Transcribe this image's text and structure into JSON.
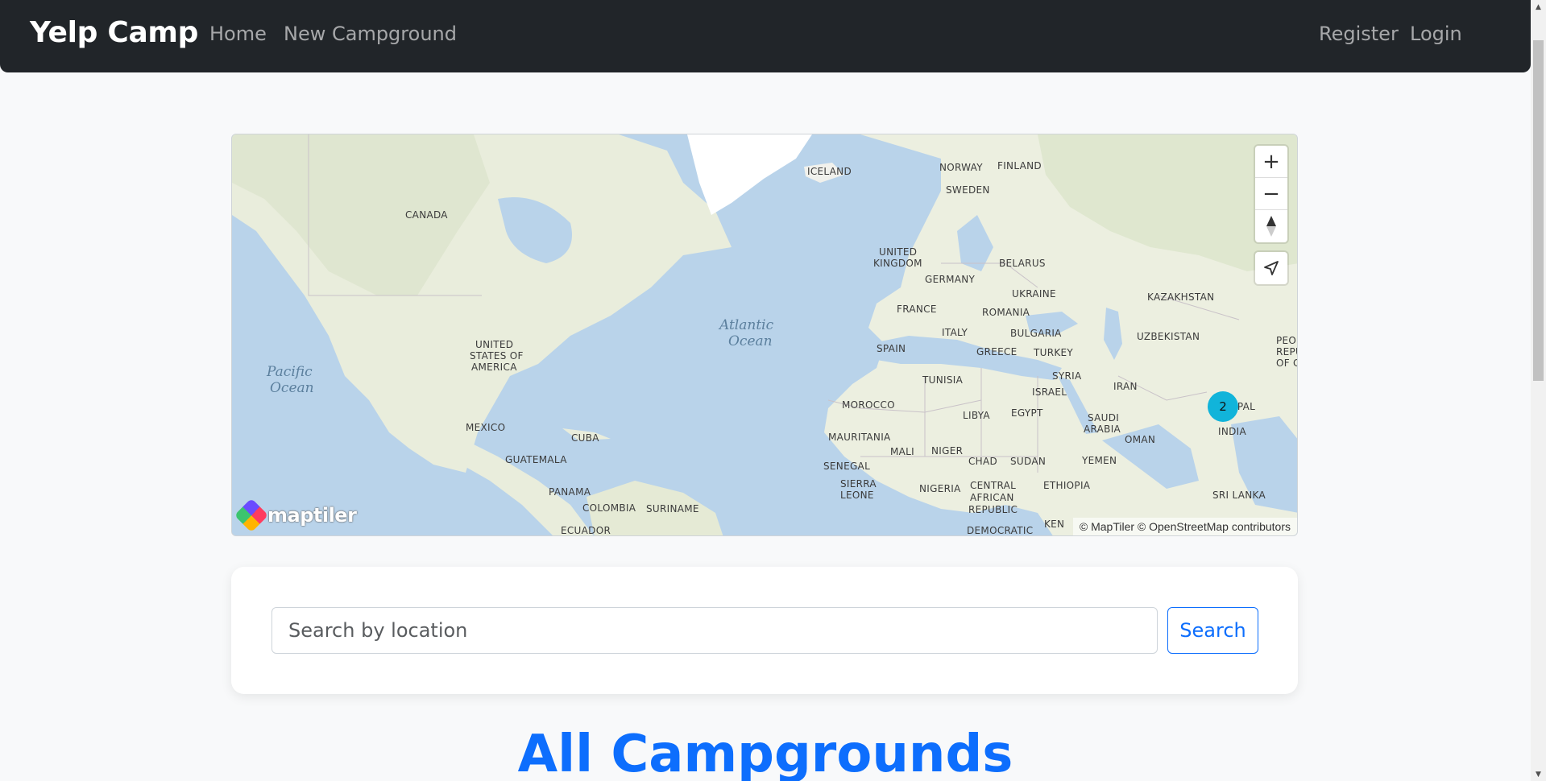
{
  "navbar": {
    "brand": "Yelp Camp",
    "links": [
      {
        "label": "Home"
      },
      {
        "label": "New Campground"
      }
    ],
    "auth": [
      {
        "label": "Register"
      },
      {
        "label": "Login"
      }
    ]
  },
  "map": {
    "oceans": [
      "Pacific",
      "Ocean",
      "Atlantic",
      "Ocean"
    ],
    "countries": [
      "ICELAND",
      "NORWAY",
      "FINLAND",
      "SWEDEN",
      "CANADA",
      "UNITED",
      "KINGDOM",
      "BELARUS",
      "GERMANY",
      "UKRAINE",
      "KAZAKHSTAN",
      "FRANCE",
      "ROMANIA",
      "ITALY",
      "BULGARIA",
      "UZBEKISTAN",
      "PEO",
      "REPU",
      "OF C",
      "UNITED",
      "STATES OF",
      "AMERICA",
      "SPAIN",
      "GREECE",
      "TURKEY",
      "TUNISIA",
      "SYRIA",
      "IRAN",
      "ISRAEL",
      "EPAL",
      "MOROCCO",
      "LIBYA",
      "EGYPT",
      "SAUDI",
      "ARABIA",
      "INDIA",
      "MEXICO",
      "CUBA",
      "MAURITANIA",
      "OMAN",
      "MALI",
      "NIGER",
      "CHAD",
      "SUDAN",
      "YEMEN",
      "GUATEMALA",
      "SENEGAL",
      "SIERRA",
      "LEONE",
      "NIGERIA",
      "CENTRAL",
      "AFRICAN",
      "REPUBLIC",
      "ETHIOPIA",
      "PANAMA",
      "SRI LANKA",
      "COLOMBIA",
      "SURINAME",
      "ECUADOR",
      "DEMOCRATIC",
      "KEN"
    ],
    "cluster_count": "2",
    "attribution": "© MapTiler © OpenStreetMap contributors",
    "logo_text": "maptiler",
    "controls": {
      "zoom_in": "+",
      "zoom_out": "−"
    }
  },
  "search": {
    "placeholder": "Search by location",
    "button_label": "Search"
  },
  "heading": "All Campgrounds",
  "colors": {
    "navbar_bg": "#212529",
    "accent": "#0d6efd",
    "cluster": "#11b4da",
    "page_bg": "#f8f9fa"
  }
}
